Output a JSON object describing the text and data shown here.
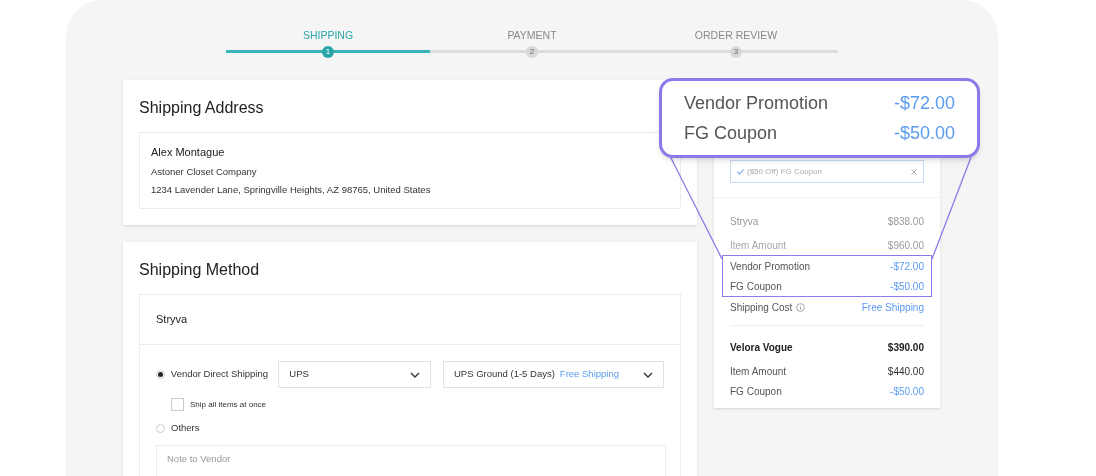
{
  "steps": [
    {
      "label": "SHIPPING",
      "number": "1",
      "selected": true
    },
    {
      "label": "PAYMENT",
      "number": "2",
      "selected": false
    },
    {
      "label": "ORDER REVIEW",
      "number": "3",
      "selected": false
    }
  ],
  "shipping_address": {
    "title": "Shipping Address",
    "name": "Alex Montague",
    "company": "Astoner Closet Company",
    "address": "1234 Lavender Lane, Springville Heights, AZ 98765, United States"
  },
  "shipping_method": {
    "title": "Shipping Method",
    "vendor": "Stryva",
    "options": [
      {
        "label": "Vendor Direct Shipping",
        "selected": true
      },
      {
        "label": "Others",
        "selected": false
      }
    ],
    "carrier": "UPS",
    "service": "UPS Ground (1-5 Days)",
    "service_price": "Free Shipping",
    "ship_all": {
      "label": "Ship all items at once",
      "checked": false
    },
    "note_placeholder": "Note to Vendor"
  },
  "summary": {
    "coupon": "($50 Off) FG Coupon",
    "groups": [
      {
        "vendor": "Stryva",
        "total": "$838.00",
        "muted": true,
        "rows": [
          {
            "label": "Item Amount",
            "value": "$960.00",
            "kind": "muted",
            "highlighted": false
          },
          {
            "label": "Vendor Promotion",
            "value": "-$72.00",
            "kind": "discount",
            "highlighted": true
          },
          {
            "label": "FG Coupon",
            "value": "-$50.00",
            "kind": "discount",
            "highlighted": true
          },
          {
            "label": "Shipping Cost",
            "value": "Free Shipping",
            "kind": "shipping",
            "highlighted": false
          }
        ]
      },
      {
        "vendor": "Velora Vogue",
        "total": "$390.00",
        "muted": false,
        "rows": [
          {
            "label": "Item Amount",
            "value": "$440.00",
            "kind": "plain",
            "highlighted": false
          },
          {
            "label": "FG Coupon",
            "value": "-$50.00",
            "kind": "discount",
            "highlighted": false
          }
        ]
      }
    ]
  },
  "callout": {
    "rows": [
      {
        "label": "Vendor Promotion",
        "value": "-$72.00"
      },
      {
        "label": "FG Coupon",
        "value": "-$50.00"
      }
    ]
  }
}
